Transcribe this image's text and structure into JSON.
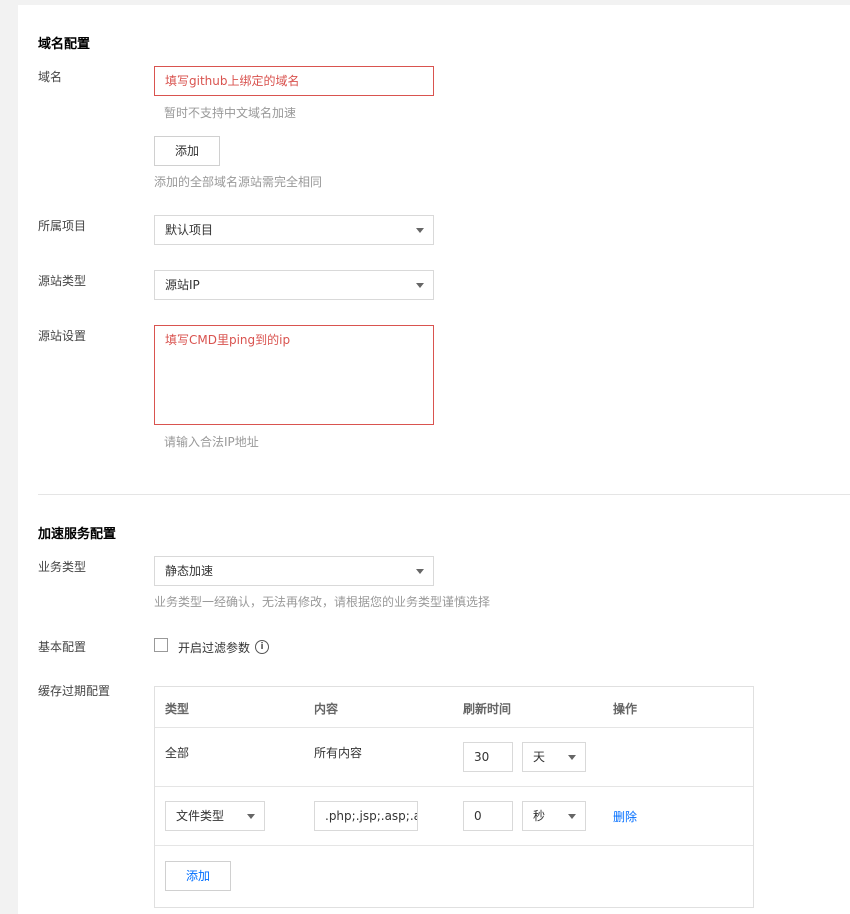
{
  "domain_section": {
    "title": "域名配置",
    "domain_label": "域名",
    "domain_value": "填写github上绑定的域名",
    "domain_hint": "暂时不支持中文域名加速",
    "add_button": "添加",
    "add_hint": "添加的全部域名源站需完全相同",
    "project_label": "所属项目",
    "project_value": "默认项目",
    "origin_type_label": "源站类型",
    "origin_type_value": "源站IP",
    "origin_setting_label": "源站设置",
    "origin_setting_value": "填写CMD里ping到的ip",
    "origin_setting_hint": "请输入合法IP地址"
  },
  "accel_section": {
    "title": "加速服务配置",
    "business_type_label": "业务类型",
    "business_type_value": "静态加速",
    "business_type_hint": "业务类型一经确认，无法再修改，请根据您的业务类型谨慎选择",
    "basic_config_label": "基本配置",
    "filter_checkbox_label": "开启过滤参数",
    "filter_checked": false,
    "cache_label": "缓存过期配置",
    "cache_table": {
      "headers": [
        "类型",
        "内容",
        "刷新时间",
        "操作"
      ],
      "row1": {
        "type": "全部",
        "content": "所有内容",
        "time": "30",
        "unit": "天"
      },
      "row2": {
        "type": "文件类型",
        "content": ".php;.jsp;.asp;.aspx",
        "time": "0",
        "unit": "秒",
        "action": "删除"
      },
      "add_button": "添加"
    }
  },
  "colors": {
    "error": "#d9534f",
    "link": "#006eff",
    "hint": "#999999"
  }
}
